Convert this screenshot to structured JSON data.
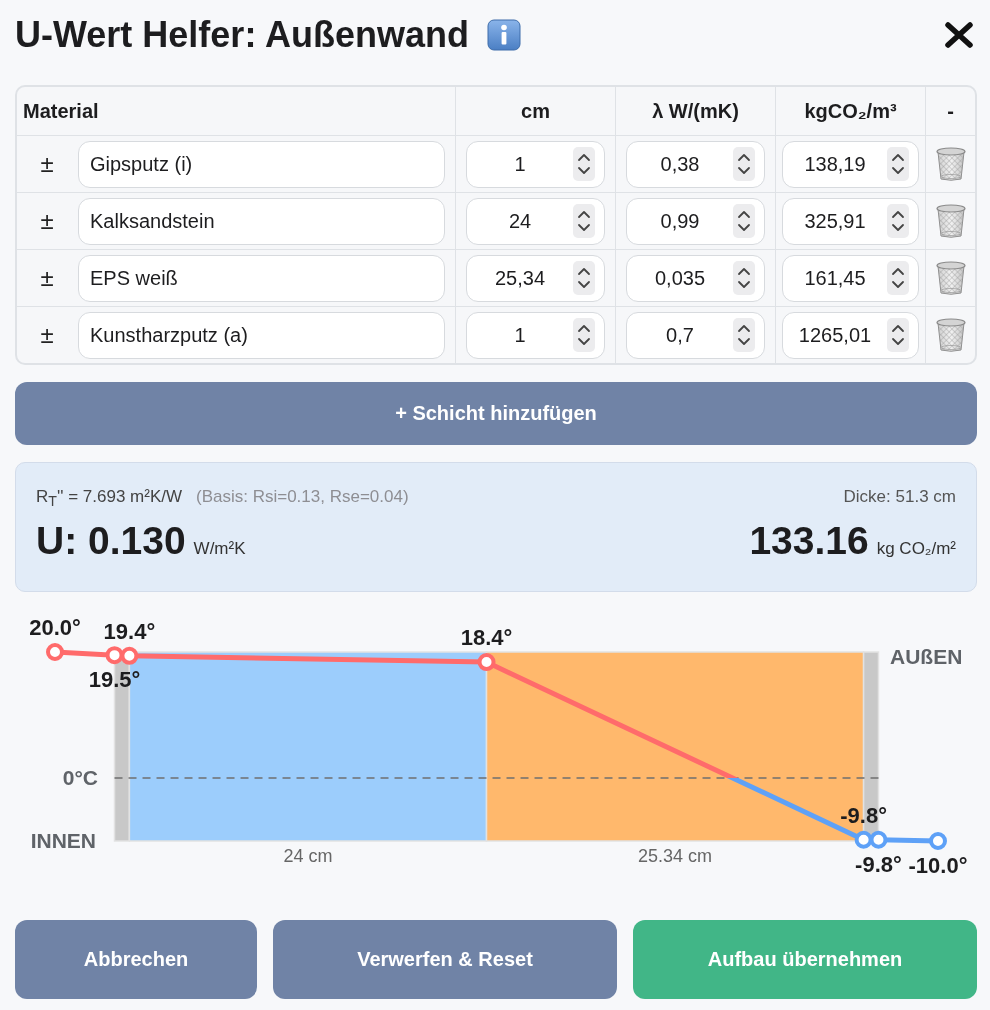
{
  "dialog": {
    "title": "U-Wert Helfer: Außenwand"
  },
  "table": {
    "columns": [
      "Material",
      "cm",
      "λ W/(mK)",
      "kgCO₂/m³",
      "-"
    ],
    "rows": [
      {
        "toggle": "±",
        "material": "Gipsputz (i)",
        "thickness": "1",
        "lambda": "0,38",
        "co2_density": "138,19"
      },
      {
        "toggle": "±",
        "material": "Kalksandstein",
        "thickness": "24",
        "lambda": "0,99",
        "co2_density": "325,91"
      },
      {
        "toggle": "±",
        "material": "EPS weiß",
        "thickness": "25,34",
        "lambda": "0,035",
        "co2_density": "161,45"
      },
      {
        "toggle": "±",
        "material": "Kunstharzputz (a)",
        "thickness": "1",
        "lambda": "0,7",
        "co2_density": "1265,01"
      }
    ]
  },
  "add_button": {
    "label": "+ Schicht hinzufügen"
  },
  "summary": {
    "resistance": "R$_{T}$'' = 7.693 m²K/W",
    "basis": "(Basis: Rsi=0.13, Rse=0.04)",
    "u_value": "U: 0.130",
    "u_unit": "W/m²K",
    "thickness": "Dicke: 51.3 cm",
    "co2": "133.16",
    "co2_unit": "kg CO₂/m²"
  },
  "profile": {
    "inside_label": "INNEN",
    "outside_label": "AUßEN",
    "zero_label": "0°C",
    "layers": [
      {
        "color": "#c8c8c8"
      },
      {
        "color": "#9ccdfc",
        "label": "24 cm"
      },
      {
        "color": "#ffb86c",
        "label": "25.34 cm"
      },
      {
        "color": "#c8c8c8"
      }
    ],
    "temperatures": [
      "20.0°",
      "19.5°",
      "19.4°",
      "18.4°",
      "-9.8°",
      "-9.8°",
      "-10.0°"
    ]
  },
  "buttons": [
    {
      "label": "Abbrechen",
      "kind": "secondary"
    },
    {
      "label": "Verwerfen & Reset",
      "kind": "secondary"
    },
    {
      "label": "Aufbau übernehmen",
      "kind": "primary"
    }
  ]
}
